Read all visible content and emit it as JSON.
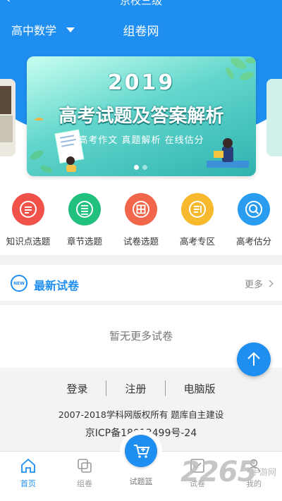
{
  "header": {
    "partial_title": "京校三级",
    "subject": "高中数学",
    "site_title": "组卷网"
  },
  "banner": {
    "year": "2019",
    "headline": "高考试题及答案解析",
    "subtitle": "高考作文  真题解析  在线估分"
  },
  "categories": [
    {
      "label": "知识点选题",
      "color": "#f0524a",
      "icon": "list-icon"
    },
    {
      "label": "章节选题",
      "color": "#21c07e",
      "icon": "chapter-icon"
    },
    {
      "label": "试卷选题",
      "color": "#f2664b",
      "icon": "grid-icon"
    },
    {
      "label": "高考专区",
      "color": "#f7b92d",
      "icon": "document-icon"
    },
    {
      "label": "高考估分",
      "color": "#2a9cf0",
      "icon": "search-icon"
    }
  ],
  "latest": {
    "badge": "NEW",
    "title": "最新试卷",
    "more": "更多"
  },
  "empty_message": "暂无更多试卷",
  "footer": {
    "login": "登录",
    "register": "注册",
    "desktop": "电脑版",
    "copyright": "2007-2018学科网版权所有 题库自主建设",
    "icp": "京ICP备18013499号-24"
  },
  "bottom_nav": {
    "home": "首页",
    "compose": "组卷",
    "basket": "试题篮",
    "papers": "试卷",
    "mine": "我的"
  },
  "watermark": {
    "number": "2265",
    "text": "手游网"
  },
  "colors": {
    "brand_blue": "#1f8ef1"
  }
}
